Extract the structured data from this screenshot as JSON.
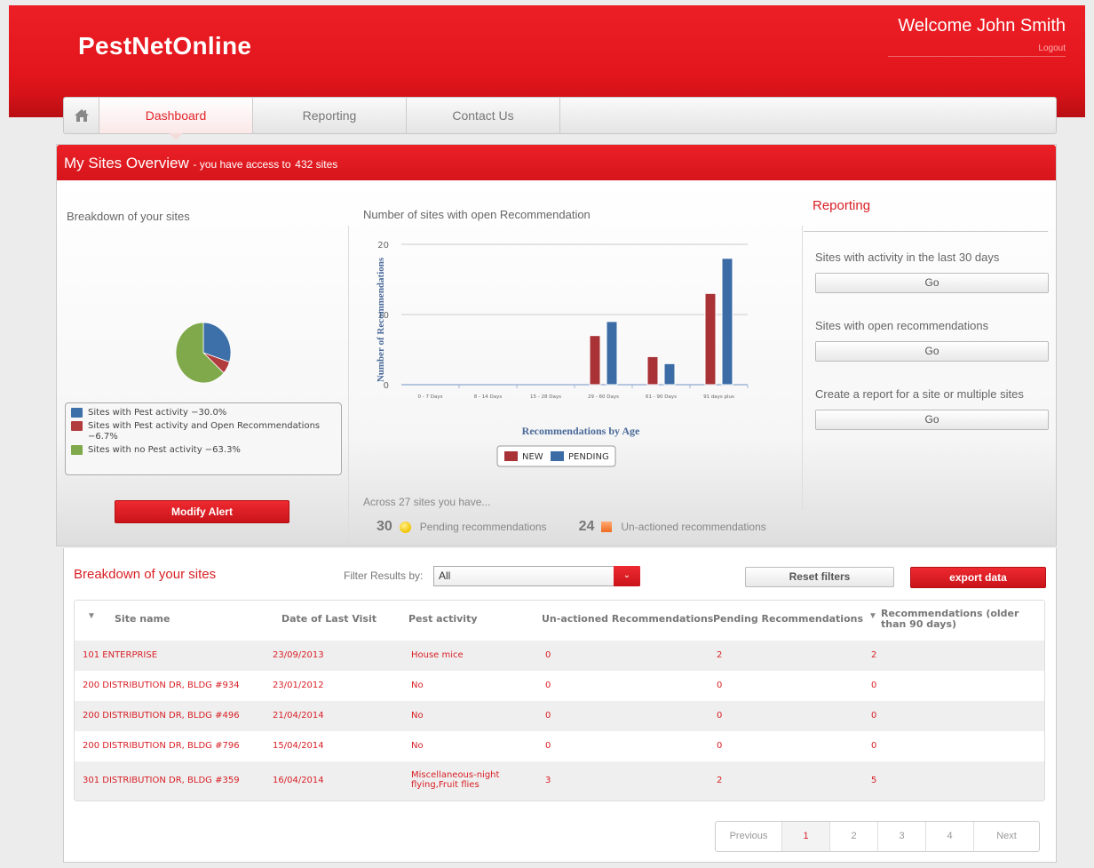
{
  "header": {
    "logo": "PestNetOnline",
    "welcome": "Welcome John Smith",
    "logout": "Logout"
  },
  "nav": {
    "tabs": [
      {
        "label": "Dashboard",
        "active": true
      },
      {
        "label": "Reporting",
        "active": false
      },
      {
        "label": "Contact Us",
        "active": false
      }
    ]
  },
  "overview": {
    "title": "My Sites Overview",
    "subtitle_prefix": "- you have access to",
    "site_count": "432 sites"
  },
  "breakdown": {
    "title": "Breakdown of your sites",
    "legend": [
      {
        "label": "Sites with Pest activity −30.0%",
        "color": "#3d6fa8",
        "percent": 30.0
      },
      {
        "label": "Sites with Pest activity and Open Recommendations −6.7%",
        "color": "#b23b3e",
        "percent": 6.7
      },
      {
        "label": "Sites with no Pest activity −63.3%",
        "color": "#7fa94a",
        "percent": 63.3
      }
    ],
    "modify_alert": "Modify Alert"
  },
  "chart_data": {
    "type": "bar",
    "title": "Number of sites with open Recommendation",
    "xlabel": "Recommendations by Age",
    "ylabel": "Number of Recommendations",
    "ylim": [
      0,
      20
    ],
    "yticks": [
      "0",
      "10",
      "20"
    ],
    "categories": [
      "0 - 7 Days",
      "8 - 14 Days",
      "15 - 28 Days",
      "29 - 60 Days",
      "61 - 90 Days",
      "91 days plus"
    ],
    "series": [
      {
        "name": "NEW",
        "color": "#a83236",
        "values": [
          0,
          0,
          0,
          7,
          4,
          13
        ]
      },
      {
        "name": "PENDING",
        "color": "#3c6ca6",
        "values": [
          0,
          0,
          0,
          9,
          3,
          18
        ]
      }
    ],
    "legend_position": "bottom",
    "grid": true
  },
  "summary": {
    "across": "Across  27 sites you have...",
    "pending_count": "30",
    "pending_label": "Pending recommendations",
    "unactioned_count": "24",
    "unactioned_label": "Un-actioned recommendations"
  },
  "reporting": {
    "title": "Reporting",
    "items": [
      {
        "text": "Sites with activity in the last 30 days",
        "button": "Go"
      },
      {
        "text": "Sites with open recommendations",
        "button": "Go"
      },
      {
        "text": "Create a report for a site or multiple sites",
        "button": "Go"
      }
    ]
  },
  "table": {
    "title": "Breakdown of your sites",
    "filter_label": "Filter Results by:",
    "filter_value": "All",
    "reset_label": "Reset filters",
    "export_label": "export data",
    "headers": [
      "Site name",
      "Date of Last Visit",
      "Pest activity",
      "Un-actioned Recommendations",
      "Pending Recommendations",
      "Recommendations (older than 90 days)"
    ],
    "rows": [
      [
        "101 ENTERPRISE",
        "23/09/2013",
        "House mice",
        "0",
        "2",
        "2"
      ],
      [
        "200 DISTRIBUTION DR, BLDG #934",
        "23/01/2012",
        "No",
        "0",
        "0",
        "0"
      ],
      [
        "200 DISTRIBUTION DR, BLDG #496",
        "21/04/2014",
        "No",
        "0",
        "0",
        "0"
      ],
      [
        "200 DISTRIBUTION DR, BLDG #796",
        "15/04/2014",
        "No",
        "0",
        "0",
        "0"
      ],
      [
        "301 DISTRIBUTION DR, BLDG #359",
        "16/04/2014",
        "Miscellaneous-night flying,Fruit flies",
        "3",
        "2",
        "5"
      ]
    ]
  },
  "pagination": {
    "previous": "Previous",
    "pages": [
      "1",
      "2",
      "3",
      "4"
    ],
    "current": "1",
    "next": "Next"
  }
}
